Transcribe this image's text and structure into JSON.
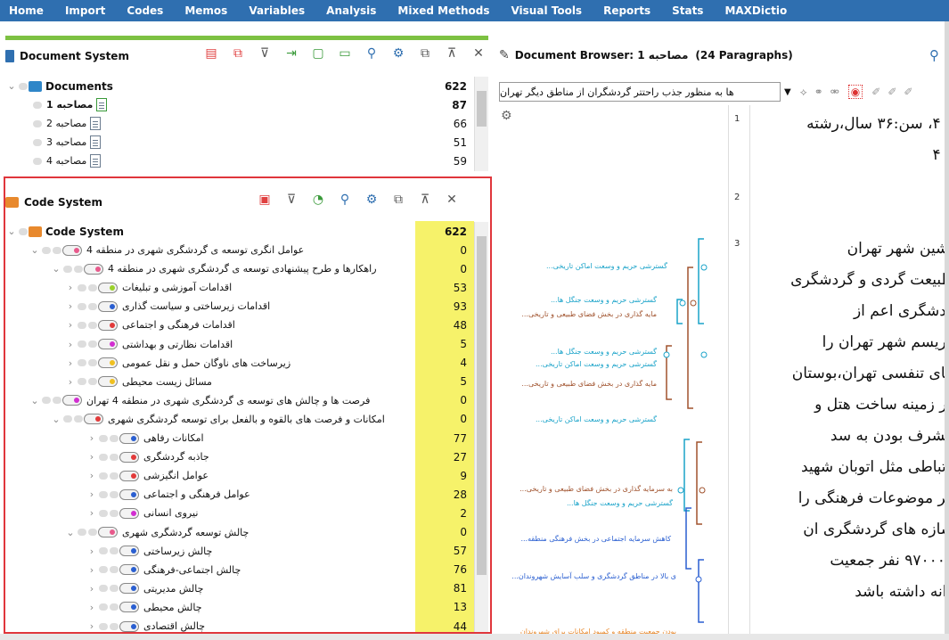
{
  "menu": [
    "Home",
    "Import",
    "Codes",
    "Memos",
    "Variables",
    "Analysis",
    "Mixed Methods",
    "Visual Tools",
    "Reports",
    "Stats",
    "MAXDictio"
  ],
  "document_system": {
    "title": "Document System",
    "root": {
      "label": "Documents",
      "count": "622"
    },
    "docs": [
      {
        "label": "مصاحبه 1",
        "count": "87"
      },
      {
        "label": "مصاحبه 2",
        "count": "66"
      },
      {
        "label": "مصاحبه 3",
        "count": "51"
      },
      {
        "label": "مصاحبه 4",
        "count": "59"
      }
    ]
  },
  "code_system": {
    "title": "Code System",
    "root": {
      "label": "Code System",
      "count": "622"
    },
    "rows": [
      {
        "label": "عوامل انگری توسعه ی گردشگری شهری در منطقه 4",
        "count": "0",
        "level": 1,
        "color": "#e85a8c"
      },
      {
        "label": "راهکارها و طرح پیشنهادی توسعه ی گردشگری شهری در منطقه 4",
        "count": "0",
        "level": 2,
        "color": "#e85a8c"
      },
      {
        "label": "اقدامات آموزشی و تبلیغات",
        "count": "53",
        "level": 3,
        "color": "#9ad12b"
      },
      {
        "label": "اقدامات زیرساختی و سیاست گذاری",
        "count": "93",
        "level": 3,
        "color": "#2a5fd1"
      },
      {
        "label": "اقدامات فرهنگی و اجتماعی",
        "count": "48",
        "level": 3,
        "color": "#e23a3a"
      },
      {
        "label": "اقدامات نظارتی و بهداشتی",
        "count": "5",
        "level": 3,
        "color": "#d22ed1"
      },
      {
        "label": "زیرساخت های ناوگان حمل و نقل عمومی",
        "count": "4",
        "level": 3,
        "color": "#f0c020"
      },
      {
        "label": "مسائل زیست محیطی",
        "count": "5",
        "level": 3,
        "color": "#f0c020"
      },
      {
        "label": "فرصت ها و چالش های توسعه ی گردشگری شهری در منطقه 4 تهران",
        "count": "0",
        "level": 1,
        "color": "#d22ed1"
      },
      {
        "label": "امکانات و فرصت های بالقوه و بالفعل برای توسعه گردشگری شهری",
        "count": "0",
        "level": 2,
        "color": "#e23a3a"
      },
      {
        "label": "امکانات رفاهی",
        "count": "77",
        "level": 4,
        "color": "#2a5fd1"
      },
      {
        "label": "جاذبه گردشگری",
        "count": "27",
        "level": 4,
        "color": "#e23a3a"
      },
      {
        "label": "عوامل انگیزشی",
        "count": "9",
        "level": 4,
        "color": "#e23a3a"
      },
      {
        "label": "عوامل فرهنگی و اجتماعی",
        "count": "28",
        "level": 4,
        "color": "#2a5fd1"
      },
      {
        "label": "نیروی انسانی",
        "count": "2",
        "level": 4,
        "color": "#d22ed1"
      },
      {
        "label": "چالش توسعه گردشگری شهری",
        "count": "0",
        "level": 3,
        "color": "#e85a8c"
      },
      {
        "label": "چالش زیرساختی",
        "count": "57",
        "level": 4,
        "color": "#2a5fd1"
      },
      {
        "label": "چالش اجتماعی-فرهنگی",
        "count": "76",
        "level": 4,
        "color": "#2a5fd1"
      },
      {
        "label": "چالش مدیریتی",
        "count": "81",
        "level": 4,
        "color": "#2a5fd1"
      },
      {
        "label": "چالش محیطی",
        "count": "13",
        "level": 4,
        "color": "#2a5fd1"
      },
      {
        "label": "چالش اقتصادی",
        "count": "44",
        "level": 4,
        "color": "#2a5fd1"
      }
    ]
  },
  "document_browser": {
    "title": "Document Browser: 1 مصاحبه",
    "paragraphs": "(24 Paragraphs)",
    "dropdown": "ها به منظور جذب راحتتر گردشگران از مناطق دیگر تهران",
    "line_numbers": [
      "1",
      "2",
      "3"
    ],
    "text_lines": [
      "ه ۴، سن:۳۶ سال،رشته",
      "ه ۴",
      "",
      "",
      "نشین شهر تهران",
      "طبیعت گردی و گردشگری",
      "ردشگری اعم از",
      "وریسم شهر تهران را",
      "های تنفسی تهران،بوستان",
      "در زمینه ساخت هتل و",
      "مشرف بودن به سد",
      "رتباطی مثل اتوبان شهید",
      "قر موضوعات فرهنگی را",
      "سازه های گردشگری ان",
      "۹۷۰۰۰۰ نفر جمعیت",
      "دانه داشته باشد"
    ],
    "coding_labels": [
      {
        "text": "گسترشی حریم و وسعت اماکن تاریخی...",
        "color": "#1aa3c9"
      },
      {
        "text": "گسترشی حریم و وسعت جنگل ها...",
        "color": "#1aa3c9"
      },
      {
        "text": "مایه گذاری در بخش فضای طبیعی و تاریخی...",
        "color": "#a0522d"
      },
      {
        "text": "گسترشی حریم و وسعت جنگل ها...",
        "color": "#1aa3c9"
      },
      {
        "text": "گسترشی حریم و وسعت اماکن تاریخی...",
        "color": "#1aa3c9"
      },
      {
        "text": "مایه گذاری در بخش فضای طبیعی و تاریخی...",
        "color": "#a0522d"
      },
      {
        "text": "گسترشی حریم و وسعت اماکن تاریخی...",
        "color": "#1aa3c9"
      },
      {
        "text": "به سرمایه گذاری در بخش فضای طبیعی و تاریخی...",
        "color": "#a0522d"
      },
      {
        "text": "گسترشی حریم و وسعت جنگل ها...",
        "color": "#1aa3c9"
      },
      {
        "text": "کاهش سرمایه اجتماعی در بخش فرهنگی منطقه...",
        "color": "#2a5fd1"
      },
      {
        "text": "ی بالا در مناطق گردشگری و سلب آسایش شهروندان...",
        "color": "#2a5fd1"
      },
      {
        "text": "بودن جمعیت منطقه و کمبود امکانات برای شهروندان",
        "color": "#e8892d"
      }
    ]
  }
}
